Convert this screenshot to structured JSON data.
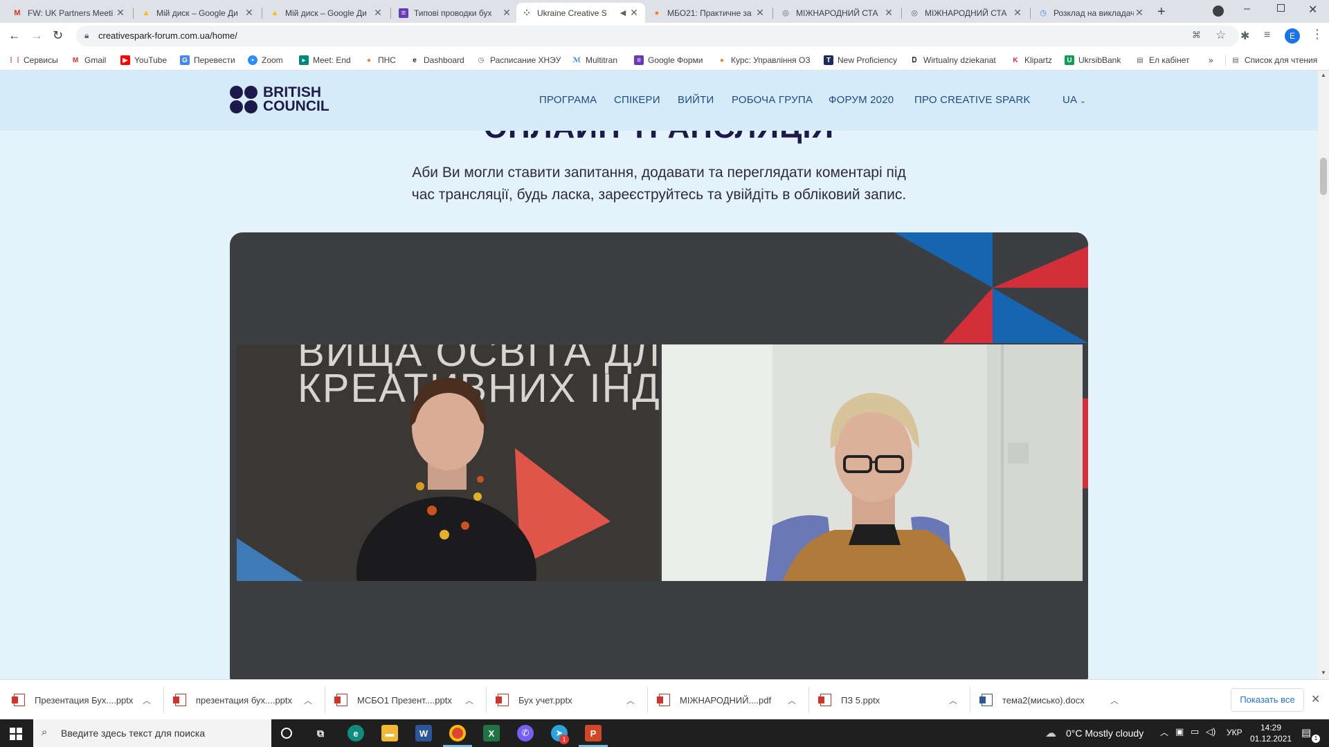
{
  "tabs": [
    {
      "title": "FW: UK Partners Meeti",
      "icon": "gmail-icon"
    },
    {
      "title": "Мій диск – Google Ди",
      "icon": "google-drive-icon"
    },
    {
      "title": "Мій диск – Google Ди",
      "icon": "google-drive-icon"
    },
    {
      "title": "Типові проводки бух",
      "icon": "forms-icon"
    },
    {
      "title": "Ukraine Creative S",
      "icon": "british-council-icon",
      "active": true
    },
    {
      "title": "МБО21: Практичне за",
      "icon": "moodle-icon"
    },
    {
      "title": "МІЖНАРОДНИЙ СТА",
      "icon": "globe-icon"
    },
    {
      "title": "МІЖНАРОДНИЙ СТА",
      "icon": "globe-icon"
    },
    {
      "title": "Розклад на викладач",
      "icon": "clock-icon"
    }
  ],
  "url": "creativespark-forum.com.ua/home/",
  "profile_initial": "E",
  "bookmarks": [
    "Сервисы",
    "Gmail",
    "YouTube",
    "Перевести",
    "Zoom",
    "Meet: End",
    "ПНС",
    "Dashboard",
    "Расписание ХНЭУ",
    "Multitran",
    "Google Форми",
    "Курс: Управління ОЗ",
    "New Proficiency",
    "Wirtualny dziekanat",
    "Klipartz",
    "UkrsibBank",
    "Ел кабінет"
  ],
  "reading_list": "Список для чтения",
  "site": {
    "logo_line1": "BRITISH",
    "logo_line2": "COUNCIL",
    "nav": [
      "ПРОГРАМА",
      "СПІКЕРИ",
      "ВИЙТИ",
      "РОБОЧА ГРУПА",
      "ФОРУМ 2020",
      "ПРО CREATIVE SPARK"
    ],
    "lang": "UA",
    "section_title": "ОНЛАЙН ТРАНСЛЯЦІЯ",
    "intro_line1": "Аби Ви могли ставити запитання, додавати та переглядати коментарі під",
    "intro_line2": "час трансляції, будь ласка, зареєструйтесь та увійдіть в обліковий запис.",
    "video_backdrop_text_line1": "ВИЩА ОСВІТА ДЛ",
    "video_backdrop_text_line2": "КРЕАТИВНИХ ІНД"
  },
  "downloads": [
    {
      "name": "Презентация Бух....pptx",
      "type": "ppt"
    },
    {
      "name": "презентация бух....pptx",
      "type": "ppt"
    },
    {
      "name": "МСБО1 Презент....pptx",
      "type": "ppt"
    },
    {
      "name": "Бух учет.pptx",
      "type": "ppt"
    },
    {
      "name": "МІЖНАРОДНИЙ....pdf",
      "type": "pdf"
    },
    {
      "name": "ПЗ 5.pptx",
      "type": "ppt"
    },
    {
      "name": "тема2(мисько).docx",
      "type": "word"
    }
  ],
  "show_all": "Показать все",
  "taskbar": {
    "search_placeholder": "Введите здесь текст для поиска",
    "weather": "0°C  Mostly cloudy",
    "lang": "УКР",
    "time": "14:29",
    "date": "01.12.2021",
    "telegram_badge": "1",
    "notifications_badge": "1"
  },
  "colors": {
    "page_bg": "#e3f2fb",
    "header_bg": "#d6ebf8",
    "nav_text": "#1c4a8a",
    "video_panel": "#3d3e42",
    "accent_red": "#d32f3a",
    "accent_blue": "#1565b0"
  }
}
